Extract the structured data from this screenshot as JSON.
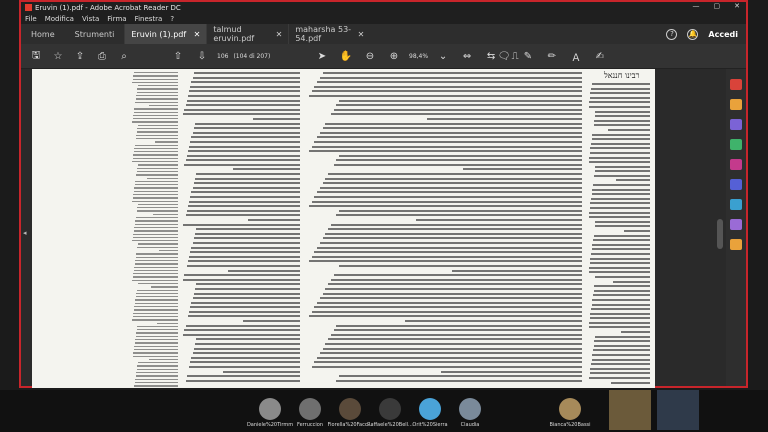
{
  "window": {
    "title": "Eruvin (1).pdf - Adobe Acrobat Reader DC",
    "controls": [
      "—",
      "▢",
      "✕"
    ]
  },
  "menu": [
    "File",
    "Modifica",
    "Vista",
    "Firma",
    "Finestra",
    "?"
  ],
  "tabs": {
    "home": "Home",
    "tools": "Strumenti",
    "documents": [
      {
        "label": "Eruvin (1).pdf",
        "active": true
      },
      {
        "label": "talmud eruvin.pdf",
        "active": false
      },
      {
        "label": "maharsha 53-54.pdf",
        "active": false
      }
    ],
    "help": "?",
    "login": "Accedi"
  },
  "toolbar": {
    "page_number": "106",
    "page_count": "(104 di 207)",
    "zoom": "98,4%"
  },
  "page": {
    "header": "רבינו חננאל"
  },
  "participants": [
    {
      "name": "Daniele%20Tirmm",
      "color": "#8a8a8a"
    },
    {
      "name": "Ferruccion",
      "color": "#6f6f6f"
    },
    {
      "name": "Fiorella%20Facc...",
      "color": "#5a4a3a"
    },
    {
      "name": "Raffaele%20Bell...",
      "color": "#3a3a3a"
    },
    {
      "name": "Orit%20Sierra",
      "color": "#4aa3d8"
    },
    {
      "name": "Claudia",
      "color": "#7a8a9a"
    },
    {
      "name": "Bianca%20Bassi",
      "color": "#a68a5a"
    }
  ],
  "colors": {
    "frame_border": "#c8252b",
    "acrobat_red": "#e23b2d"
  }
}
